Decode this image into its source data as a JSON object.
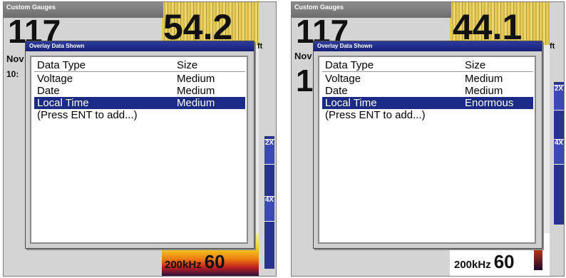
{
  "screens": [
    {
      "title": "Custom Gauges",
      "big_left": "117",
      "big_right": "54.2",
      "unit": "ft",
      "side_labels": [
        "Nov",
        "10:"
      ],
      "scale_ticks": [
        "2X",
        "4X"
      ],
      "freq_label": "200kHz",
      "freq_value": "60",
      "dialog": {
        "title": "Overlay Data Shown",
        "headers": {
          "type": "Data Type",
          "size": "Size"
        },
        "rows": [
          {
            "type": "Voltage",
            "size": "Medium"
          },
          {
            "type": "Date",
            "size": "Medium"
          },
          {
            "type": "Local Time",
            "size": "Medium"
          },
          {
            "type": "(Press ENT to add...)",
            "size": ""
          }
        ]
      }
    },
    {
      "title": "Custom Gauges",
      "big_left": "117",
      "big_right": "44.1",
      "unit": "ft",
      "side_labels": [
        "Nov"
      ],
      "scale_ticks": [
        "2X",
        "4X"
      ],
      "freq_label": "200kHz",
      "freq_value": "60",
      "dialog": {
        "title": "Overlay Data Shown",
        "headers": {
          "type": "Data Type",
          "size": "Size"
        },
        "rows": [
          {
            "type": "Voltage",
            "size": "Medium"
          },
          {
            "type": "Date",
            "size": "Medium"
          },
          {
            "type": "Local Time",
            "size": "Enormous"
          },
          {
            "type": "(Press ENT to add...)",
            "size": ""
          }
        ]
      }
    }
  ]
}
